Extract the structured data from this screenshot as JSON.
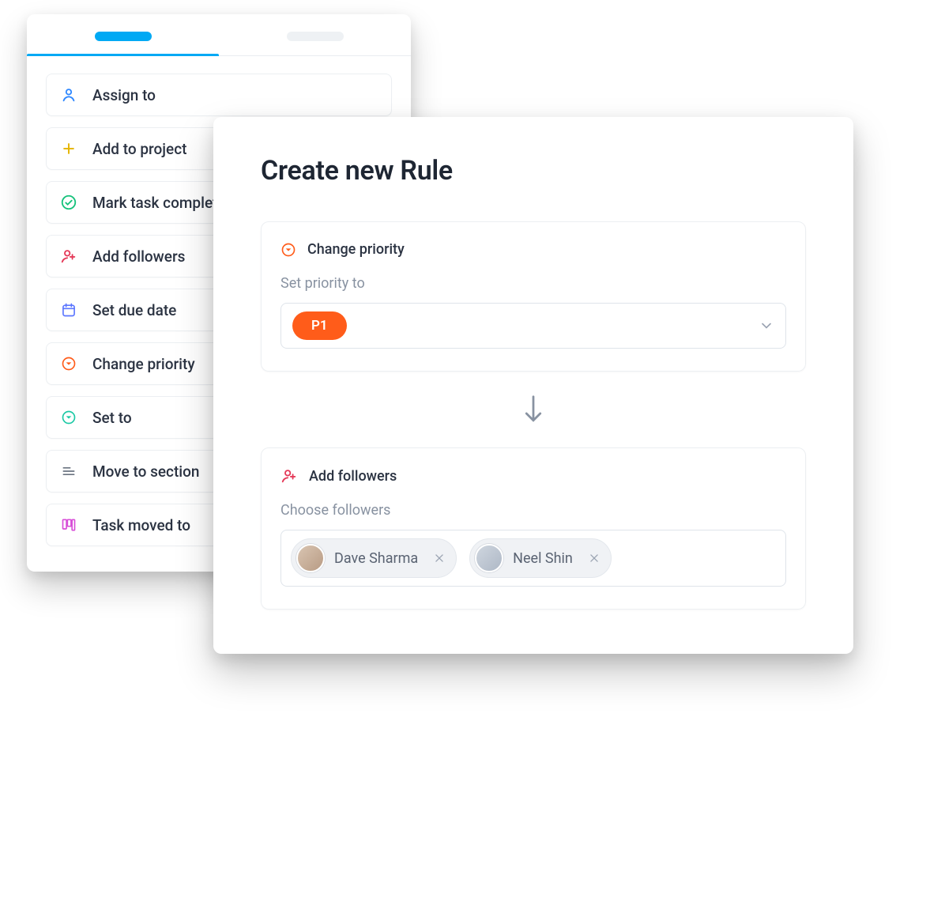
{
  "actions_list": {
    "items": [
      {
        "label": "Assign to"
      },
      {
        "label": "Add to project"
      },
      {
        "label": "Mark task complete"
      },
      {
        "label": "Add followers"
      },
      {
        "label": "Set due date"
      },
      {
        "label": "Change priority"
      },
      {
        "label": "Set to"
      },
      {
        "label": "Move to section"
      },
      {
        "label": "Task moved to"
      }
    ]
  },
  "panel": {
    "title": "Create new Rule",
    "step1": {
      "title": "Change priority",
      "field_label": "Set priority to",
      "selected_value": "P1"
    },
    "step2": {
      "title": "Add followers",
      "field_label": "Choose followers",
      "chips": [
        {
          "name": "Dave Sharma"
        },
        {
          "name": "Neel Shin"
        }
      ]
    }
  },
  "colors": {
    "accent_blue": "#00a9f4",
    "accent_orange": "#ff5c1a"
  }
}
